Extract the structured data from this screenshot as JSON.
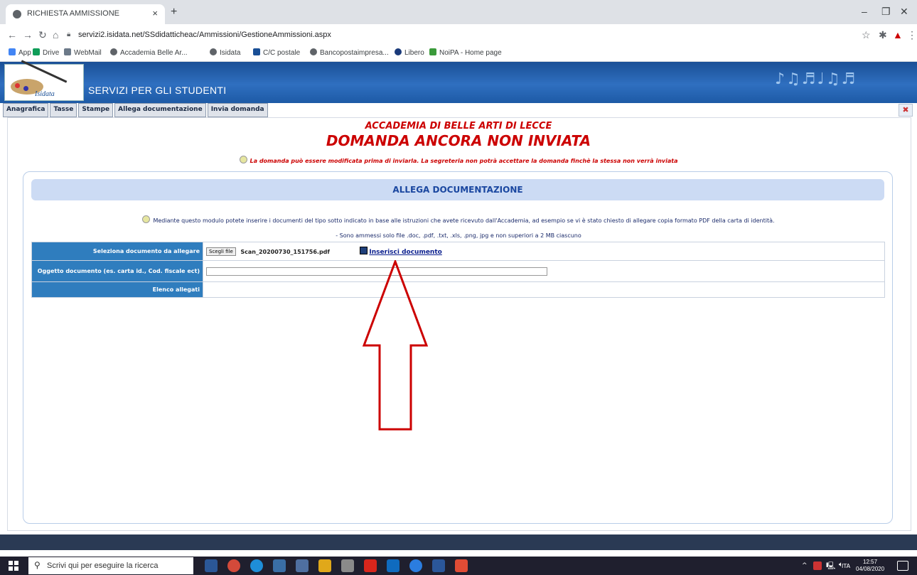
{
  "browser": {
    "tab_title": "RICHIESTA AMMISSIONE",
    "tab_close": "×",
    "new_tab": "+",
    "url": "servizi2.isidata.net/SSdidatticheac/Ammissioni/GestioneAmmissioni.aspx",
    "bookmarks": [
      "App",
      "Drive",
      "WebMail",
      "Accademia Belle Ar...",
      "Isidata",
      "C/C postale",
      "Bancopostaimpresa...",
      "Libero",
      "NoiPA - Home page"
    ]
  },
  "site": {
    "title": "SERVIZI PER GLI STUDENTI",
    "logo_text": "Isidata",
    "menu": [
      "Anagrafica",
      "Tasse",
      "Stampe",
      "Allega documentazione",
      "Invia domanda"
    ]
  },
  "main": {
    "institution": "ACCADEMIA DI BELLE ARTI DI LECCE",
    "status": "DOMANDA ANCORA NON INVIATA",
    "warning": "La domanda può essere modificata prima di inviarla. La segreteria non potrà accettare la domanda finchè la stessa non verrà inviata",
    "section_title": "ALLEGA DOCUMENTAZIONE",
    "instructions": "Mediante questo modulo potete inserire i documenti del tipo sotto indicato in base alle istruzioni che avete ricevuto dall'Accademia, ad esempio se vi è stato chiesto di allegare copia formato PDF della carta di identità.",
    "allowed_files": "- Sono ammessi solo file .doc, .pdf, .txt, .xls, .png, jpg e non superiori a 2 MB ciascuno"
  },
  "form": {
    "select_label": "Seleziona documento da allegare",
    "choose_button": "Scegli file",
    "chosen_file": "Scan_20200730_151756.pdf",
    "insert_link": "Inserisci documento",
    "subject_label": "Oggetto documento (es. carta id., Cod. fiscale ect)",
    "subject_value": "",
    "attachments_label": "Elenco allegati"
  },
  "taskbar": {
    "search_placeholder": "Scrivi qui per eseguire la ricerca",
    "language": "ITA",
    "time": "12:57",
    "date": "04/08/2020"
  },
  "colors": {
    "header_blue": "#2f6fc0",
    "label_blue": "#2f7dbe",
    "alert_red": "#cc0000",
    "arrow_red": "#cc0000"
  }
}
